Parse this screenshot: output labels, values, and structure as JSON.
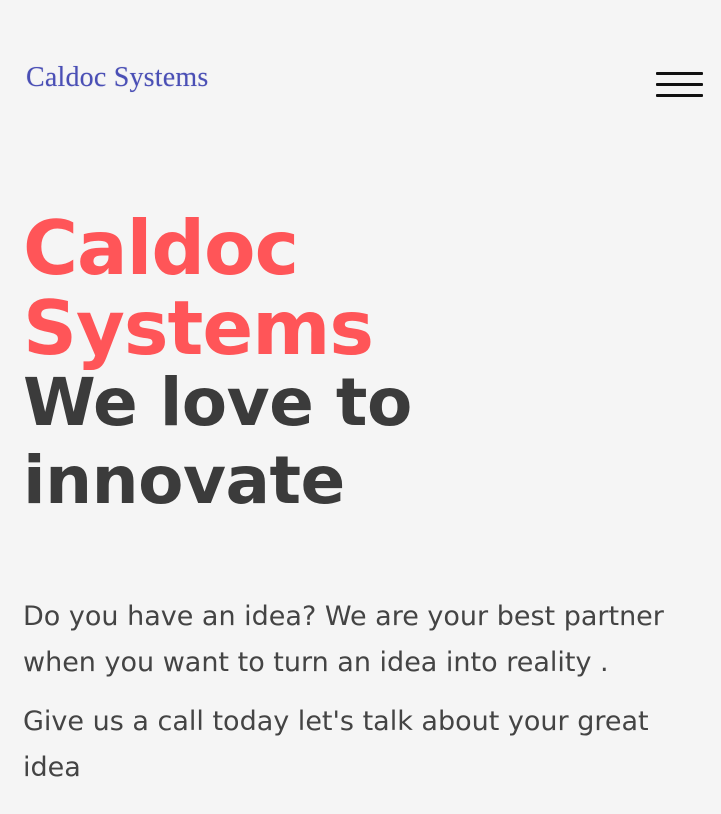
{
  "header": {
    "logo_text": "Caldoc Systems",
    "menu_icon": "hamburger-menu-icon"
  },
  "hero": {
    "brand_line1": "Caldoc",
    "brand_line2": "Systems",
    "tagline_line1": "We love to",
    "tagline_line2": "innovate"
  },
  "content": {
    "paragraph1": "Do you have an idea? We are your best partner when you want to turn an idea into reality .",
    "paragraph2": "Give us a call today let's talk about your great idea"
  },
  "colors": {
    "background": "#f5f5f5",
    "logo": "#4a4fb5",
    "brand": "#ff5558",
    "tagline": "#3b3b3b",
    "body_text": "#444444"
  }
}
